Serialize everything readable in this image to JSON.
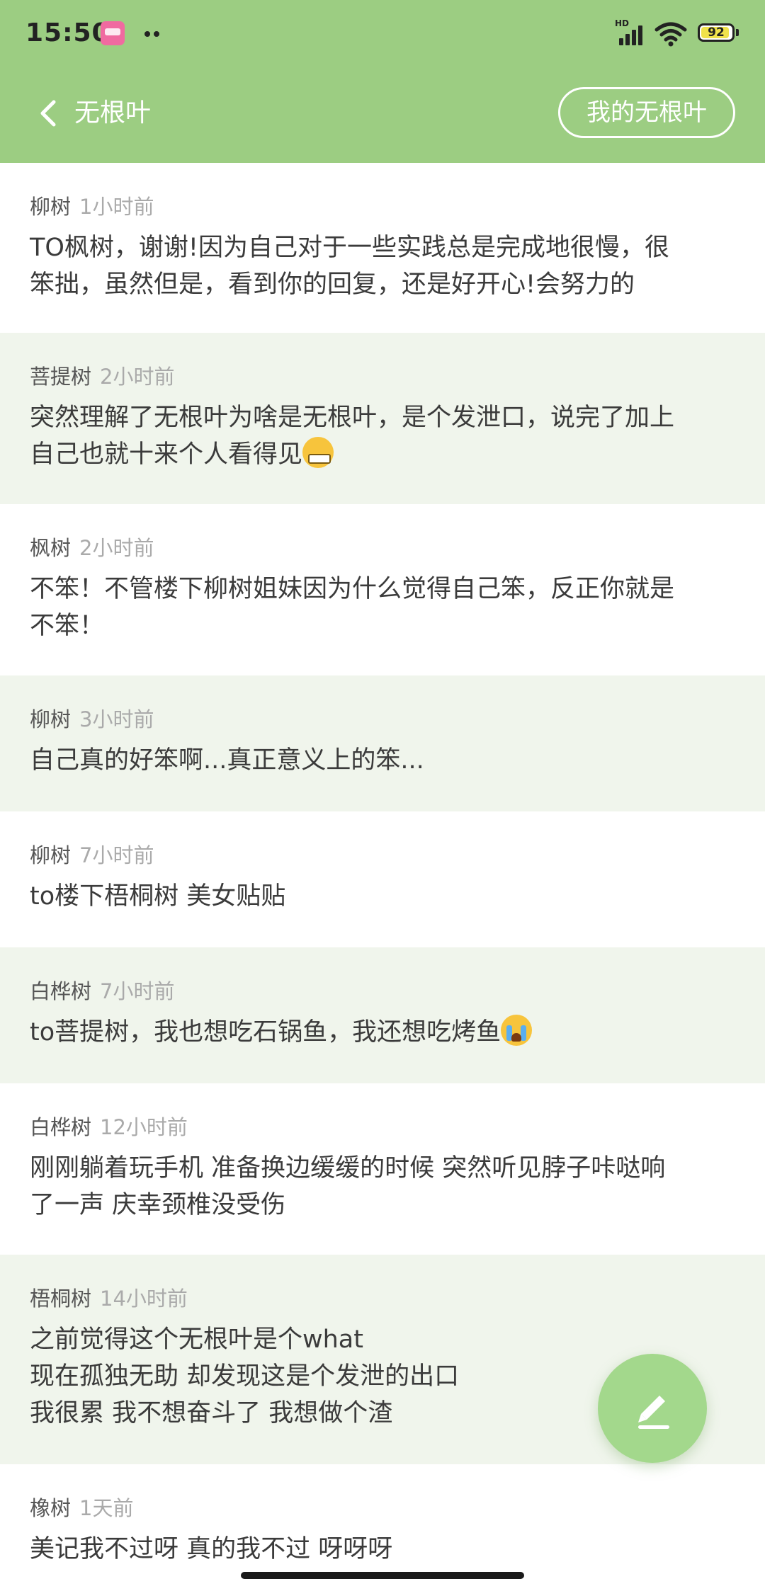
{
  "status_bar": {
    "time": "15:50",
    "network": "HD",
    "battery_level": "92",
    "battery_fraction": 0.92
  },
  "header": {
    "title": "无根叶",
    "my_button": "我的无根叶",
    "background_color": "#9ccd82"
  },
  "posts": [
    {
      "author": "柳树",
      "time": "1小时前",
      "body": "TO枫树，谢谢!因为自己对于一些实践总是完成地很慢，很\n笨拙，虽然但是，看到你的回复，还是好开心!会努力的",
      "emoji": ""
    },
    {
      "author": "菩提树",
      "time": "2小时前",
      "body": "突然理解了无根叶为啥是无根叶，是个发泄口，说完了加上\n自己也就十来个人看得见",
      "emoji": "grimacing-face"
    },
    {
      "author": "枫树",
      "time": "2小时前",
      "body": "不笨！不管楼下柳树姐妹因为什么觉得自己笨，反正你就是\n不笨！",
      "emoji": ""
    },
    {
      "author": "柳树",
      "time": "3小时前",
      "body": "自己真的好笨啊...真正意义上的笨...",
      "emoji": ""
    },
    {
      "author": "柳树",
      "time": "7小时前",
      "body": "to楼下梧桐树 美女贴贴",
      "emoji": ""
    },
    {
      "author": "白桦树",
      "time": "7小时前",
      "body": "to菩提树，我也想吃石锅鱼，我还想吃烤鱼",
      "emoji": "loudly-crying-face"
    },
    {
      "author": "白桦树",
      "time": "12小时前",
      "body": "刚刚躺着玩手机 准备换边缓缓的时候 突然听见脖子咔哒响\n了一声 庆幸颈椎没受伤",
      "emoji": ""
    },
    {
      "author": "梧桐树",
      "time": "14小时前",
      "body": "之前觉得这个无根叶是个what\n现在孤独无助 却发现这是个发泄的出口\n我很累 我不想奋斗了 我想做个渣",
      "emoji": ""
    },
    {
      "author": "橡树",
      "time": "1天前",
      "body": "美记我不过呀 真的我不过 呀呀呀",
      "emoji": ""
    }
  ],
  "fab": {
    "icon": "pencil-icon",
    "color": "#a3d88c"
  }
}
